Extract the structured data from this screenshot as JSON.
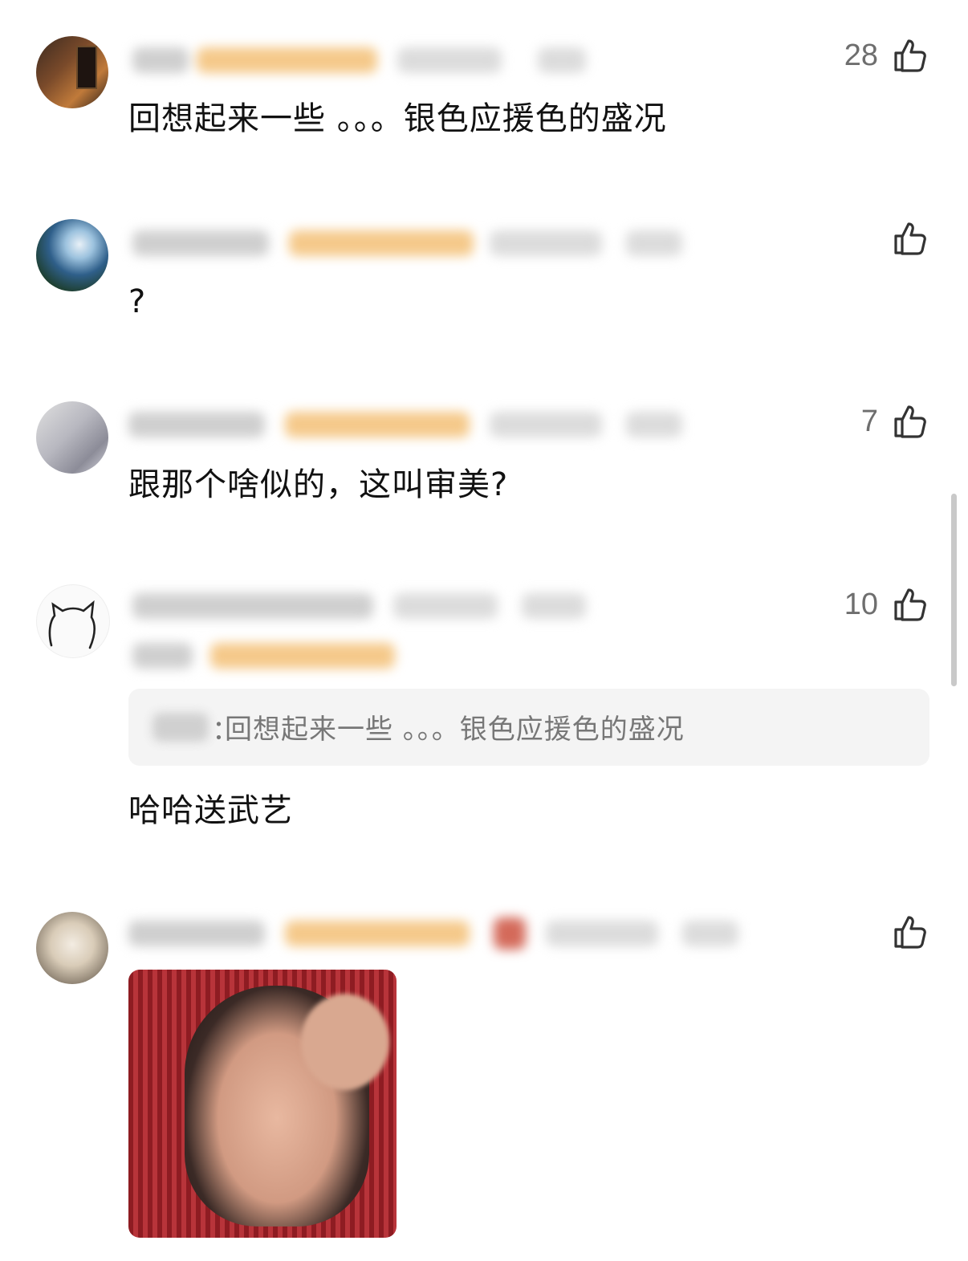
{
  "comments": [
    {
      "text": "回想起来一些 。。。银色应援色的盛况",
      "likes": "28"
    },
    {
      "text": "?",
      "likes": ""
    },
    {
      "text": "跟那个啥似的，这叫审美?",
      "likes": "7"
    },
    {
      "text": "哈哈送武艺",
      "likes": "10",
      "quote": "回想起来一些 。。。银色应援色的盛况",
      "quote_colon": "："
    },
    {
      "text": "",
      "likes": ""
    }
  ],
  "icons": {
    "like": "thumbs-up-icon"
  },
  "colors": {
    "text": "#111111",
    "like_count": "#6e6e6e",
    "quote_bg": "#f4f4f4",
    "badge": "#f5c98a"
  }
}
